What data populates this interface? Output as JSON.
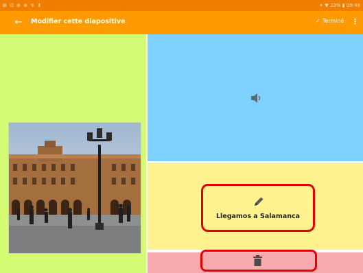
{
  "statusbar": {
    "left_icons": "⊞ ⊡ ⊕ ⊗ ↯ ⬇",
    "right_status": "✦ ▼ 33% ▮ 09:48"
  },
  "appbar": {
    "back_icon": "arrow-left-icon",
    "title": "Modifier cette diapositive",
    "faint_actions": ". .",
    "done_label": "Terminé",
    "done_icon": "check-icon",
    "overflow_icon": "more-vertical-icon"
  },
  "slide": {
    "caption": "Llegamos a Salamanca",
    "photo_icon": "photo-plaza-mayor",
    "sound_icon": "speaker-icon",
    "edit_icon": "pencil-icon",
    "delete_icon": "trash-icon"
  },
  "colors": {
    "status_bar": "#f07e00",
    "app_bar": "#ff9a00",
    "photo_panel": "#d4fb73",
    "sound_panel": "#7fd1ff",
    "text_panel": "#fff390",
    "delete_panel": "#f7a9ad",
    "highlight": "#e20000"
  }
}
